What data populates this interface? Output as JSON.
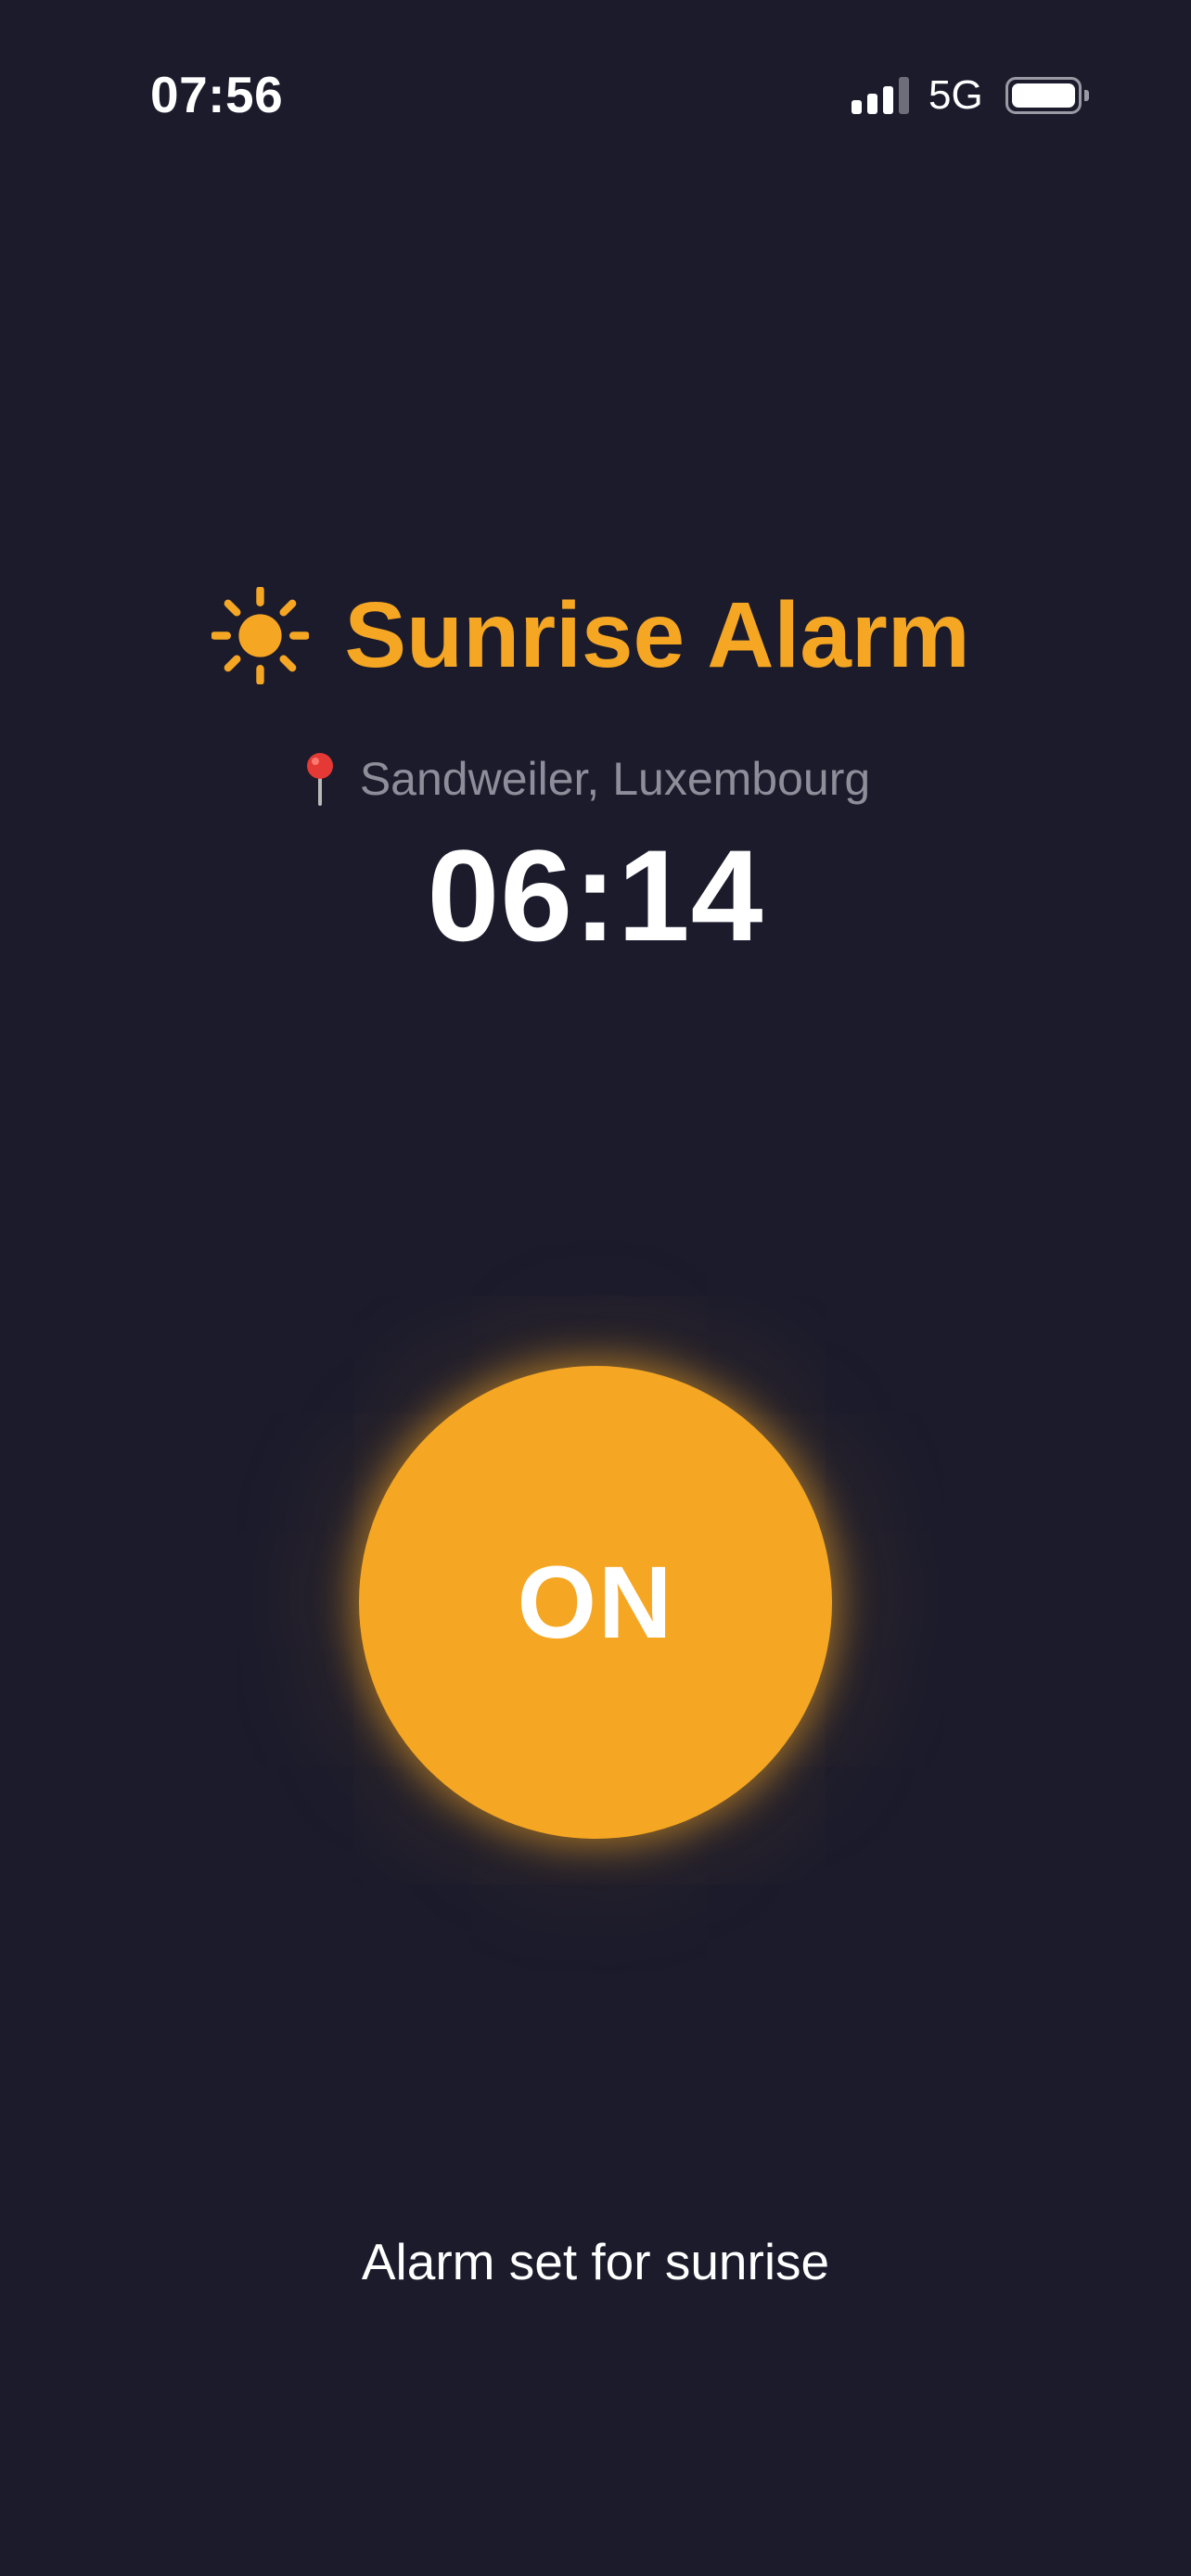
{
  "status_bar": {
    "time": "07:56",
    "network": "5G",
    "signal_bars_active": 3,
    "signal_bars_total": 4,
    "battery_level": 1.0
  },
  "header": {
    "icon": "sun-icon",
    "title": "Sunrise Alarm"
  },
  "location": {
    "icon": "pin-icon",
    "label": "Sandweiler, Luxembourg"
  },
  "alarm": {
    "time": "06:14",
    "toggle_label": "ON",
    "status_text": "Alarm set for sunrise"
  },
  "colors": {
    "background": "#1b1b2c",
    "accent": "#f5a623",
    "muted_text": "#8e8e9a",
    "pin_red": "#e53935"
  }
}
